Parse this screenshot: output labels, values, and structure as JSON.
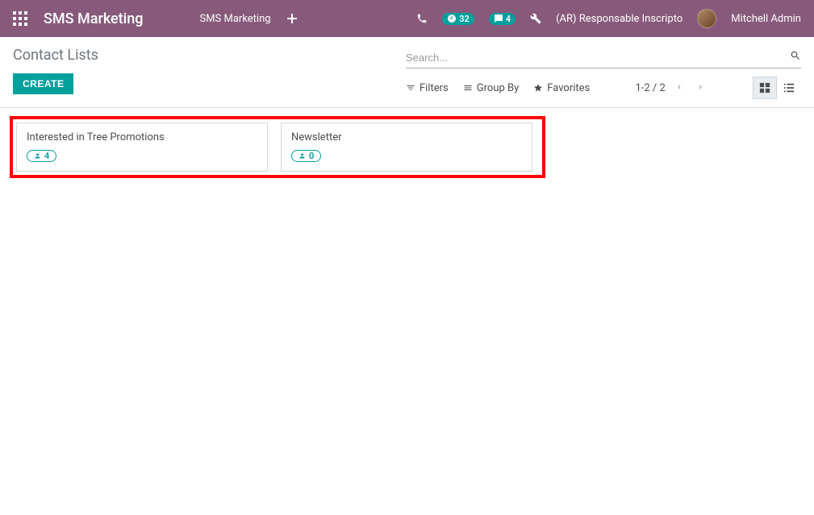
{
  "topbar": {
    "app_title": "SMS Marketing",
    "menu_item": "SMS Marketing",
    "activities_count": "32",
    "messages_count": "4",
    "company": "(AR) Responsable Inscripto",
    "user": "Mitchell Admin"
  },
  "page": {
    "breadcrumb": "Contact Lists",
    "create_label": "CREATE"
  },
  "search": {
    "placeholder": "Search..."
  },
  "toolbar": {
    "filters_label": "Filters",
    "groupby_label": "Group By",
    "favorites_label": "Favorites",
    "pager": "1-2 / 2"
  },
  "cards": [
    {
      "title": "Interested in Tree Promotions",
      "count": "4"
    },
    {
      "title": "Newsletter",
      "count": "0"
    }
  ]
}
